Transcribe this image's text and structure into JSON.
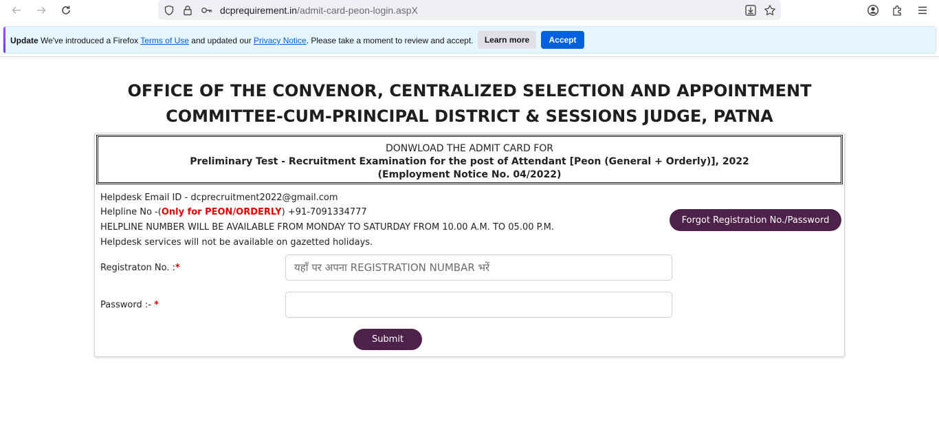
{
  "browser": {
    "url_domain": "dcprequirement.in",
    "url_path": "/admit-card-peon-login.aspX",
    "icons": [
      "back-icon",
      "forward-icon",
      "reload-icon",
      "shield-icon",
      "lock-icon",
      "key-icon",
      "download-page-icon",
      "star-icon",
      "account-icon",
      "extensions-icon",
      "menu-icon"
    ]
  },
  "notice": {
    "label": "Update",
    "text_before": " We've introduced a Firefox ",
    "terms_link": "Terms of Use",
    "text_mid": " and updated our ",
    "privacy_link": "Privacy Notice",
    "text_after": ". Please take a moment to review and accept.",
    "learn_more": "Learn more",
    "accept": "Accept"
  },
  "page": {
    "heading_line1": "OFFICE OF THE CONVENOR, CENTRALIZED SELECTION AND APPOINTMENT",
    "heading_line2": "COMMITTEE-CUM-PRINCIPAL DISTRICT & SESSIONS JUDGE, PATNA",
    "title_line1": "DONWLOAD THE ADMIT CARD FOR",
    "title_line2": "Preliminary Test - Recruitment Examination for the post of Attendant [Peon (General + Orderly)], 2022",
    "title_line3": "(Employment Notice No. 04/2022)",
    "helpdesk_email": "Helpdesk Email ID - dcprecruitment2022@gmail.com",
    "helpline_prefix": "Helpline No -(",
    "helpline_red": "Only for PEON/ORDERLY",
    "helpline_suffix": ") +91-7091334777",
    "helpline_hours": "HELPLINE NUMBER WILL BE AVAILABLE FROM MONDAY TO SATURDAY FROM 10.00 A.M. TO 05.00 P.M.",
    "holiday_note": "Helpdesk services will not be available on gazetted holidays.",
    "forgot_button": "Forgot Registration No./Password",
    "reg_label": "Registraton No. :",
    "reg_star": "*",
    "reg_placeholder": "यहाँ पर अपना REGISTRATION NUMBAR भरें",
    "pwd_label": "Password :- ",
    "pwd_star": "*",
    "submit": "Submit"
  }
}
